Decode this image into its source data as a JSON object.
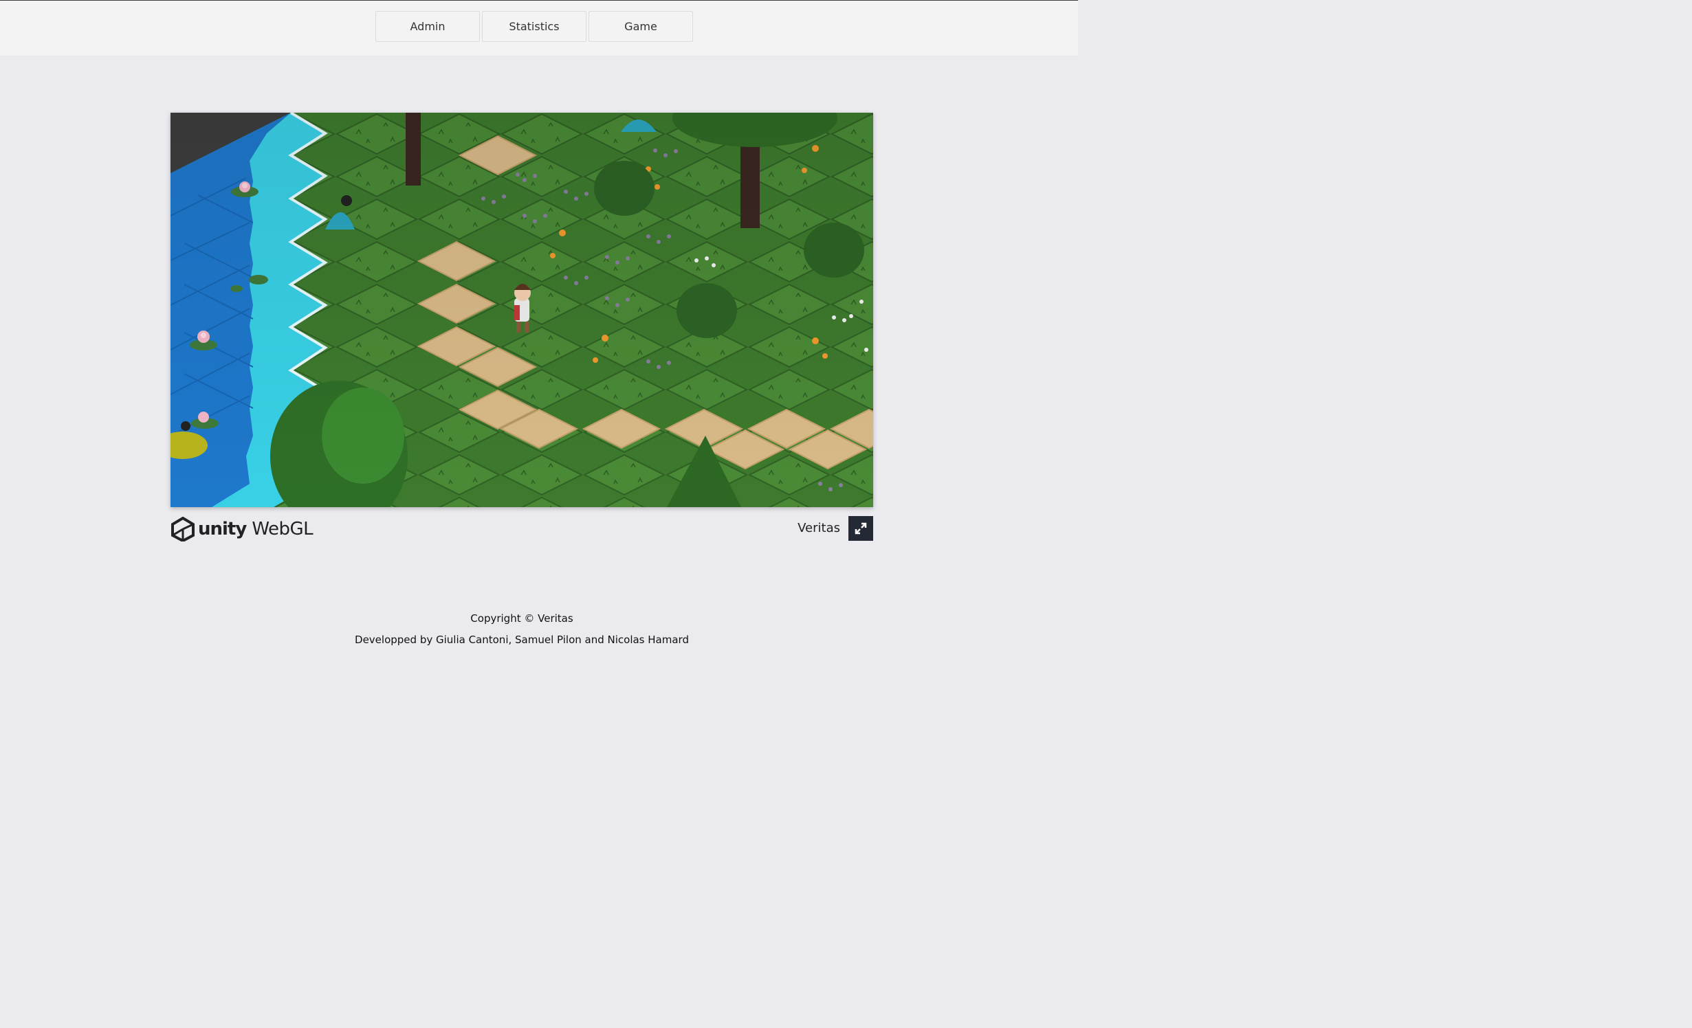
{
  "nav": {
    "items": [
      {
        "label": "Admin"
      },
      {
        "label": "Statistics"
      },
      {
        "label": "Game"
      }
    ]
  },
  "game": {
    "title": "Veritas",
    "engine_logo": {
      "word": "unity",
      "product": "WebGL"
    },
    "fullscreen_icon": "expand-arrows-icon"
  },
  "footer": {
    "copyright": "Copyright © Veritas",
    "developers": "Developped by Giulia Cantoni, Samuel Pilon and Nicolas Hamard"
  },
  "colors": {
    "grass": "#3f7a2e",
    "water_deep": "#1c74c9",
    "water_light": "#37d3e6",
    "path": "#d8b884",
    "fullscreen_button": "#232a36"
  }
}
